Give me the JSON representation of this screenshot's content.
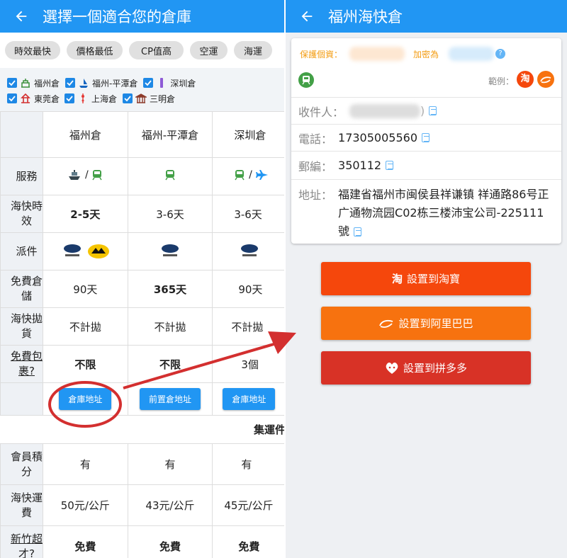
{
  "left": {
    "title": "選擇一個適合您的倉庫",
    "chips": [
      "時效最快",
      "價格最低",
      "CP值高",
      "空運",
      "海運"
    ],
    "filters": [
      "福州倉",
      "福州-平潭倉",
      "深圳倉",
      "東莞倉",
      "上海倉",
      "三明倉"
    ],
    "columns": [
      "福州倉",
      "福州-平潭倉",
      "深圳倉"
    ],
    "rows": {
      "service_label": "服務",
      "speed_label": "海快時效",
      "speed": [
        "2-5天",
        "3-6天",
        "3-6天"
      ],
      "delivery_label": "派件",
      "storage_label": "免費倉儲",
      "storage": [
        "90天",
        "365天",
        "90天"
      ],
      "bulky_label": "海快拋貨",
      "bulky": [
        "不計拋",
        "不計拋",
        "不計拋"
      ],
      "free_label": "免費包裹?",
      "free": [
        "不限",
        "不限",
        "3個"
      ],
      "buttons": [
        "倉庫地址",
        "前置倉地址",
        "倉庫地址"
      ],
      "section": "集運件",
      "points_label": "會員積分",
      "points": [
        "有",
        "有",
        "有"
      ],
      "fee_label": "海快運費",
      "fee": [
        "50元/公斤",
        "43元/公斤",
        "45元/公斤"
      ],
      "hsinchu_label": "新竹超才?",
      "hsinchu": [
        "免費",
        "免費",
        "免費"
      ]
    }
  },
  "right": {
    "title": "福州海快倉",
    "protect_label": "保護個資：",
    "encrypt_label": "加密為",
    "example_label": "範例：",
    "recipient_label": "收件人：",
    "recipient_suffix": ")",
    "phone_label": "電話：",
    "phone": "17305005560",
    "zip_label": "郵編：",
    "zip": "350112",
    "address_label": "地址：",
    "address": "福建省福州市闽侯县祥谦镇 祥通路86号正广通物流园C02栋三楼沛宝公司-225111號",
    "buttons": {
      "taobao": "設置到淘寶",
      "alibaba": "設置到阿里巴巴",
      "pinduoduo": "設置到拼多多"
    },
    "taobao_glyph": "淘",
    "colors": {
      "taobao": "#f5470c",
      "alibaba": "#f7720f",
      "pinduoduo": "#d83226",
      "primary": "#2196f3"
    }
  }
}
